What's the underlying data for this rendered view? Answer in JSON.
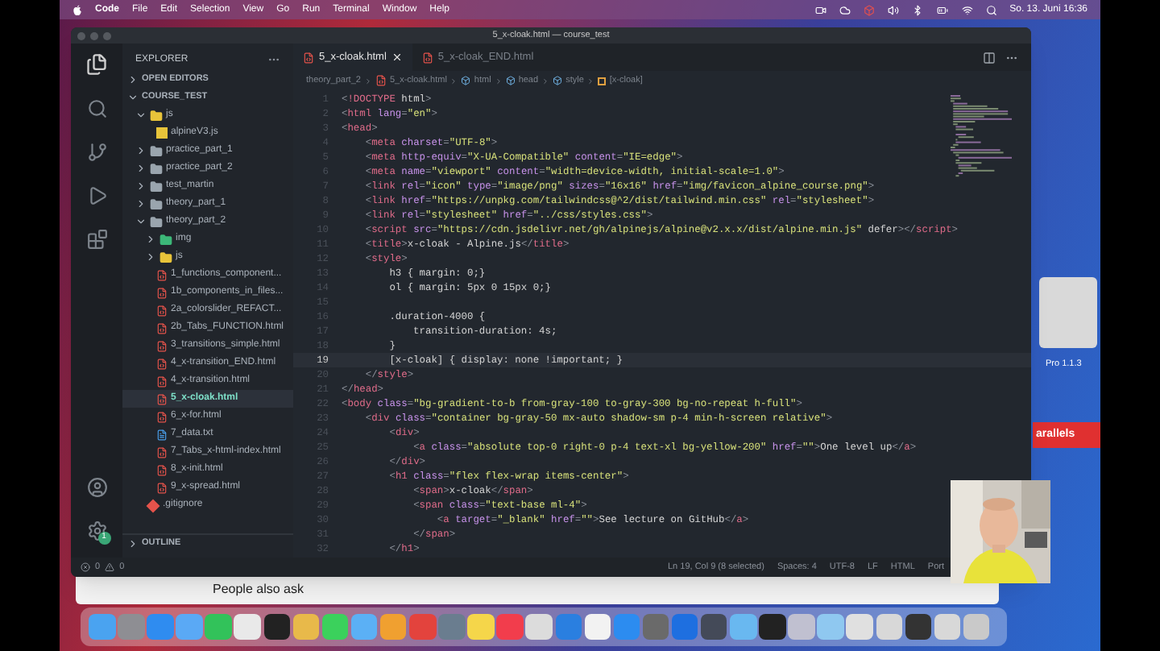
{
  "menubar": {
    "app": "Code",
    "menus": [
      "File",
      "Edit",
      "Selection",
      "View",
      "Go",
      "Run",
      "Terminal",
      "Window",
      "Help"
    ],
    "clock": "So. 13. Juni 16:36"
  },
  "window": {
    "title": "5_x-cloak.html — course_test"
  },
  "activity": {
    "settings_badge": "1"
  },
  "sidebar": {
    "title": "EXPLORER",
    "open_editors": "OPEN EDITORS",
    "project": "COURSE_TEST",
    "outline": "OUTLINE",
    "tree": [
      {
        "name": "js",
        "kind": "js-folder",
        "expanded": true,
        "selected": false,
        "children": [
          {
            "name": "alpineV3.js",
            "kind": "js",
            "selected": false
          }
        ]
      },
      {
        "name": "practice_part_1",
        "kind": "folder",
        "expanded": false,
        "selected": false
      },
      {
        "name": "practice_part_2",
        "kind": "folder",
        "expanded": false,
        "selected": false
      },
      {
        "name": "test_martin",
        "kind": "folder",
        "expanded": false,
        "selected": false
      },
      {
        "name": "theory_part_1",
        "kind": "folder",
        "expanded": false,
        "selected": false
      },
      {
        "name": "theory_part_2",
        "kind": "folder",
        "expanded": true,
        "selected": false,
        "children": [
          {
            "name": "img",
            "kind": "img-folder",
            "expanded": false,
            "selected": false
          },
          {
            "name": "js",
            "kind": "js-folder",
            "expanded": false,
            "selected": false
          },
          {
            "name": "1_functions_component...",
            "kind": "html",
            "selected": false
          },
          {
            "name": "1b_components_in_files...",
            "kind": "html",
            "selected": false
          },
          {
            "name": "2a_colorslider_REFACT...",
            "kind": "html",
            "selected": false
          },
          {
            "name": "2b_Tabs_FUNCTION.html",
            "kind": "html",
            "selected": false
          },
          {
            "name": "3_transitions_simple.html",
            "kind": "html",
            "selected": false
          },
          {
            "name": "4_x-transition_END.html",
            "kind": "html",
            "selected": false
          },
          {
            "name": "4_x-transition.html",
            "kind": "html",
            "selected": false
          },
          {
            "name": "5_x-cloak.html",
            "kind": "html",
            "selected": true
          },
          {
            "name": "6_x-for.html",
            "kind": "html",
            "selected": false
          },
          {
            "name": "7_data.txt",
            "kind": "txt",
            "selected": false
          },
          {
            "name": "7_Tabs_x-html-index.html",
            "kind": "html",
            "selected": false
          },
          {
            "name": "8_x-init.html",
            "kind": "html",
            "selected": false
          },
          {
            "name": "9_x-spread.html",
            "kind": "html",
            "selected": false
          }
        ]
      },
      {
        "name": ".gitignore",
        "kind": "git",
        "selected": false
      }
    ]
  },
  "tabs": [
    {
      "label": "5_x-cloak.html",
      "selected": true
    },
    {
      "label": "5_x-cloak_END.html",
      "selected": false
    }
  ],
  "breadcrumb": [
    {
      "label": "theory_part_2",
      "kind": "folder"
    },
    {
      "label": "5_x-cloak.html",
      "kind": "html"
    },
    {
      "label": "html",
      "kind": "element"
    },
    {
      "label": "head",
      "kind": "element"
    },
    {
      "label": "style",
      "kind": "element"
    },
    {
      "label": "[x-cloak]",
      "kind": "selector"
    }
  ],
  "code": [
    {
      "n": "1",
      "text": "<!DOCTYPE html>",
      "active": false
    },
    {
      "n": "2",
      "text": "<html lang=\"en\">",
      "active": false
    },
    {
      "n": "3",
      "text": "<head>",
      "active": false
    },
    {
      "n": "4",
      "text": "    <meta charset=\"UTF-8\">",
      "active": false
    },
    {
      "n": "5",
      "text": "    <meta http-equiv=\"X-UA-Compatible\" content=\"IE=edge\">",
      "active": false
    },
    {
      "n": "6",
      "text": "    <meta name=\"viewport\" content=\"width=device-width, initial-scale=1.0\">",
      "active": false
    },
    {
      "n": "7",
      "text": "    <link rel=\"icon\" type=\"image/png\" sizes=\"16x16\" href=\"img/favicon_alpine_course.png\">",
      "active": false
    },
    {
      "n": "8",
      "text": "    <link href=\"https://unpkg.com/tailwindcss@^2/dist/tailwind.min.css\" rel=\"stylesheet\">",
      "active": false
    },
    {
      "n": "9",
      "text": "    <link rel=\"stylesheet\" href=\"../css/styles.css\">",
      "active": false
    },
    {
      "n": "10",
      "text": "    <script src=\"https://cdn.jsdelivr.net/gh/alpinejs/alpine@v2.x.x/dist/alpine.min.js\" defer></script>",
      "active": false
    },
    {
      "n": "11",
      "text": "    <title>x-cloak - Alpine.js</title>",
      "active": false
    },
    {
      "n": "12",
      "text": "    <style>",
      "active": false
    },
    {
      "n": "13",
      "text": "        h3 { margin: 0;}",
      "active": false
    },
    {
      "n": "14",
      "text": "        ol { margin: 5px 0 15px 0;}",
      "active": false
    },
    {
      "n": "15",
      "active": false
    },
    {
      "n": "16",
      "text": "        .duration-4000 {",
      "active": false
    },
    {
      "n": "17",
      "text": "            transition-duration: 4s;",
      "active": false
    },
    {
      "n": "18",
      "text": "        }",
      "active": false
    },
    {
      "n": "19",
      "text": "        [x-cloak] { display: none !important; }",
      "active": true
    },
    {
      "n": "20",
      "text": "    </style>",
      "active": false
    },
    {
      "n": "21",
      "text": "</head>",
      "active": false
    },
    {
      "n": "22",
      "text": "<body class=\"bg-gradient-to-b from-gray-100 to-gray-300 bg-no-repeat h-full\">",
      "active": false
    },
    {
      "n": "23",
      "text": "    <div class=\"container bg-gray-50 mx-auto shadow-sm p-4 min-h-screen relative\">",
      "active": false
    },
    {
      "n": "24",
      "text": "        <div>",
      "active": false
    },
    {
      "n": "25",
      "text": "            <a class=\"absolute top-0 right-0 p-4 text-xl bg-yellow-200\" href=\"\">One level up</a>",
      "active": false
    },
    {
      "n": "26",
      "text": "        </div>",
      "active": false
    },
    {
      "n": "27",
      "text": "        <h1 class=\"flex flex-wrap items-center\">",
      "active": false
    },
    {
      "n": "28",
      "text": "            <span>x-cloak</span>",
      "active": false
    },
    {
      "n": "29",
      "text": "            <span class=\"text-base ml-4\">",
      "active": false
    },
    {
      "n": "30",
      "text": "                <a target=\"_blank\" href=\"\">See lecture on GitHub</a>",
      "active": false
    },
    {
      "n": "31",
      "text": "            </span>",
      "active": false
    },
    {
      "n": "32",
      "text": "        </h1>",
      "active": false
    }
  ],
  "status_bar": {
    "errors": "0",
    "warnings": "0",
    "items": [
      "Ln 19, Col 9 (8 selected)",
      "Spaces: 4",
      "UTF-8",
      "LF",
      "HTML",
      "Port"
    ]
  },
  "browser": {
    "heading": "People also ask"
  },
  "desktop": [
    {
      "label": "Pro 1.1.3",
      "kind": "disk"
    },
    {
      "label": "arallels",
      "kind": "logo"
    }
  ]
}
